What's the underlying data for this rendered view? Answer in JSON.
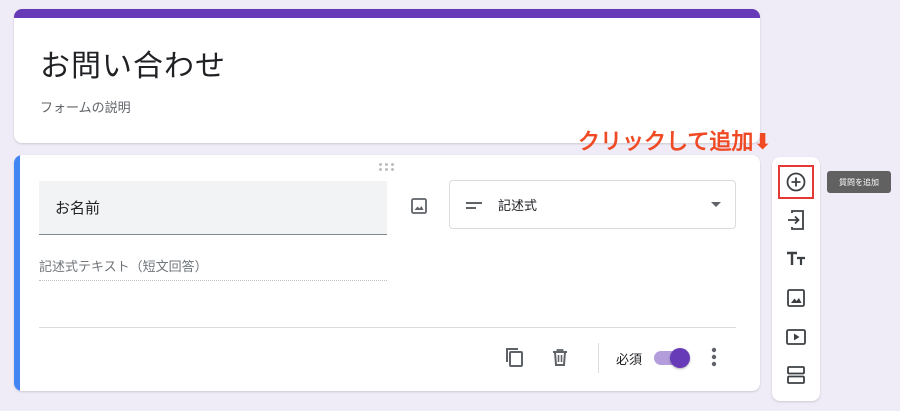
{
  "form": {
    "title": "お問い合わせ",
    "description": "フォームの説明"
  },
  "annotation": {
    "text": "クリックして追加⬇"
  },
  "question": {
    "title": "お名前",
    "type_label": "記述式",
    "answer_hint": "記述式テキスト（短文回答）",
    "required_label": "必須",
    "required": true
  },
  "toolbar": {
    "tooltip": "質問を追加",
    "tools": [
      "add-question-icon",
      "import-questions-icon",
      "add-title-icon",
      "add-image-icon",
      "add-video-icon",
      "add-section-icon"
    ]
  },
  "colors": {
    "accent": "#673ab7",
    "question_accent": "#4285f4",
    "annotation": "#f04a24",
    "highlight_border": "#e53935"
  }
}
